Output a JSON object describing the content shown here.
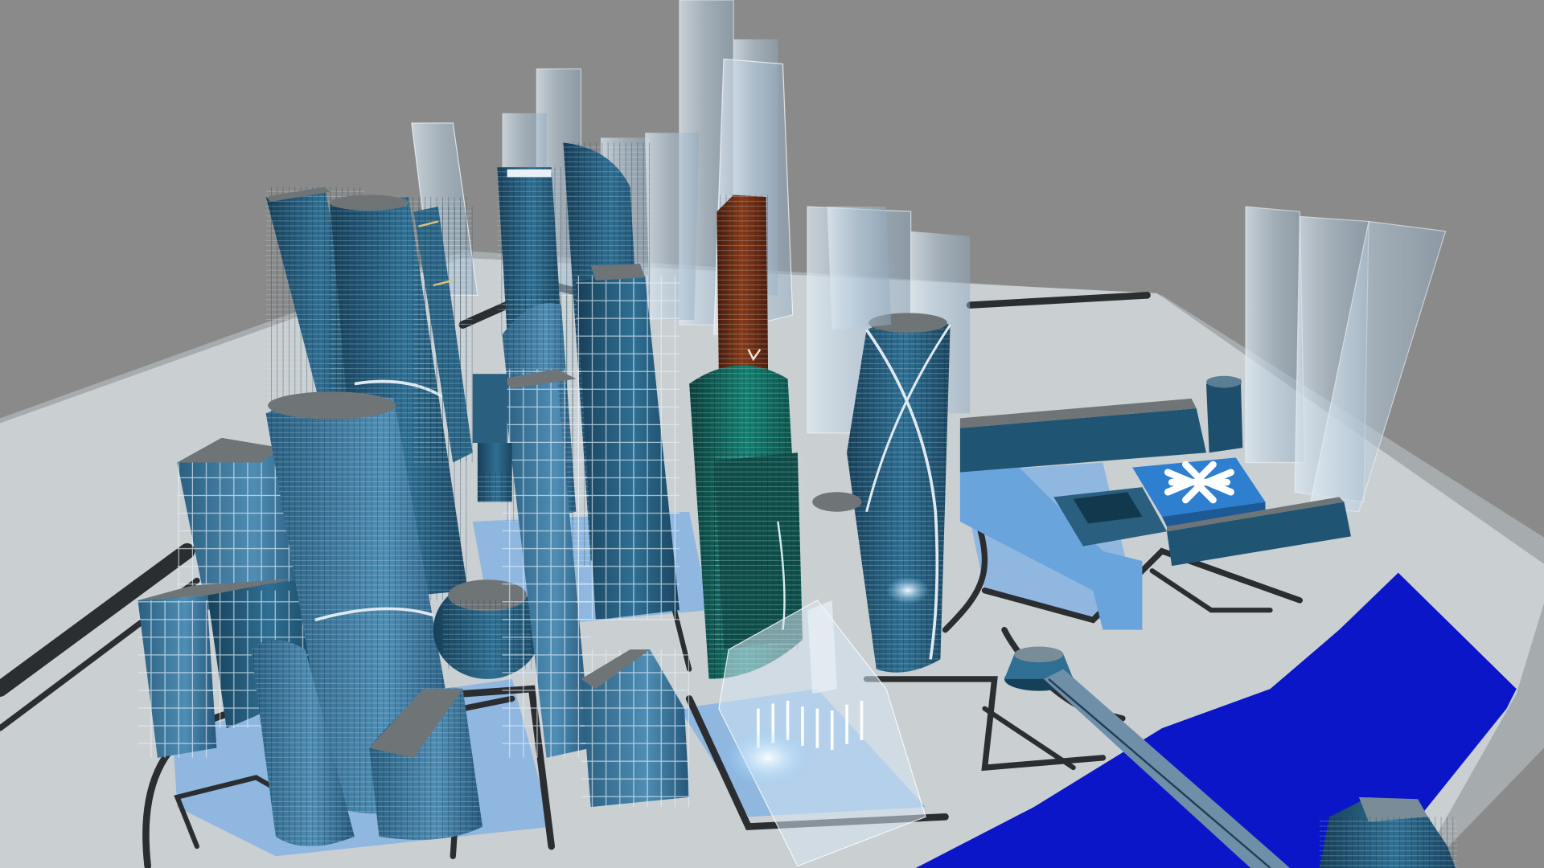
{
  "scene": {
    "subject": "3d-city-model",
    "colors": {
      "background": "#8a8a8a",
      "platform": "#c9ced1",
      "platform_shadow": "#a6abae",
      "plaza": "#8fb7e0",
      "road": "#2b2e31",
      "water": "#0a16c8",
      "tower_dark": "#1d4f6c",
      "tower_mid": "#2f6f93",
      "tower_light": "#5a98bf",
      "glass": "#b9cfe0",
      "copper": "#6a2b12",
      "green_glass": "#0f5a52",
      "roof": "#6f7477",
      "logo_pad": "#2f7fd0",
      "logo": "#ffffff"
    }
  }
}
